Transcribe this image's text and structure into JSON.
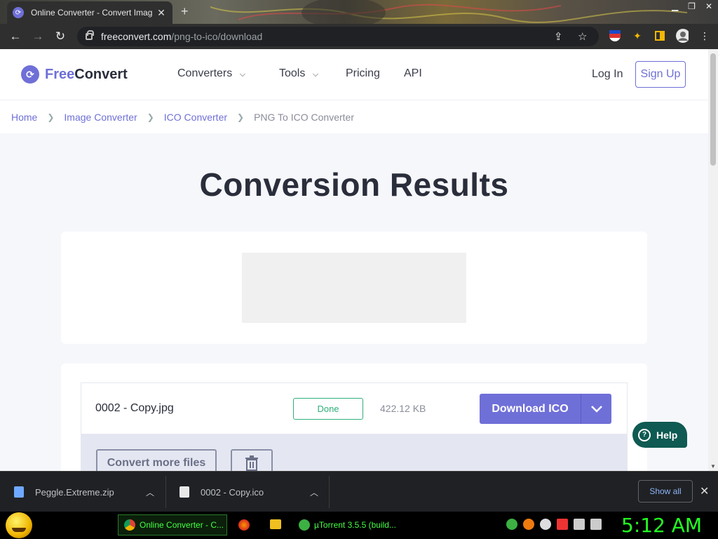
{
  "browser": {
    "tab_title": "Online Converter - Convert Imag",
    "tab_close": "✕",
    "new_tab": "+",
    "url_host": "freeconvert.com",
    "url_path": "/png-to-ico/download"
  },
  "nav": {
    "logo_free": "Free",
    "logo_convert": "Convert",
    "converters": "Converters",
    "tools": "Tools",
    "pricing": "Pricing",
    "api": "API",
    "login": "Log In",
    "signup": "Sign Up"
  },
  "breadcrumb": {
    "home": "Home",
    "image_converter": "Image Converter",
    "ico_converter": "ICO Converter",
    "current": "PNG To ICO Converter"
  },
  "heading": "Conversion Results",
  "file": {
    "name": "0002 - Copy.jpg",
    "status": "Done",
    "size": "422.12 KB",
    "download_label": "Download ICO"
  },
  "actions": {
    "convert_more": "Convert more files"
  },
  "help": {
    "label": "Help"
  },
  "downloads": {
    "items": [
      {
        "name": "Peggle.Extreme.zip"
      },
      {
        "name": "0002 - Copy.ico"
      }
    ],
    "show_all": "Show all"
  },
  "taskbar": {
    "items": [
      {
        "label": "Online Converter - C..."
      },
      {
        "label": "µTorrent 3.5.5  (build..."
      }
    ],
    "clock": "5:12 AM"
  },
  "colors": {
    "brand": "#6f6fd8",
    "done_green": "#2fb07a",
    "help_teal": "#0f5a52",
    "clock_green": "#22ff22"
  }
}
